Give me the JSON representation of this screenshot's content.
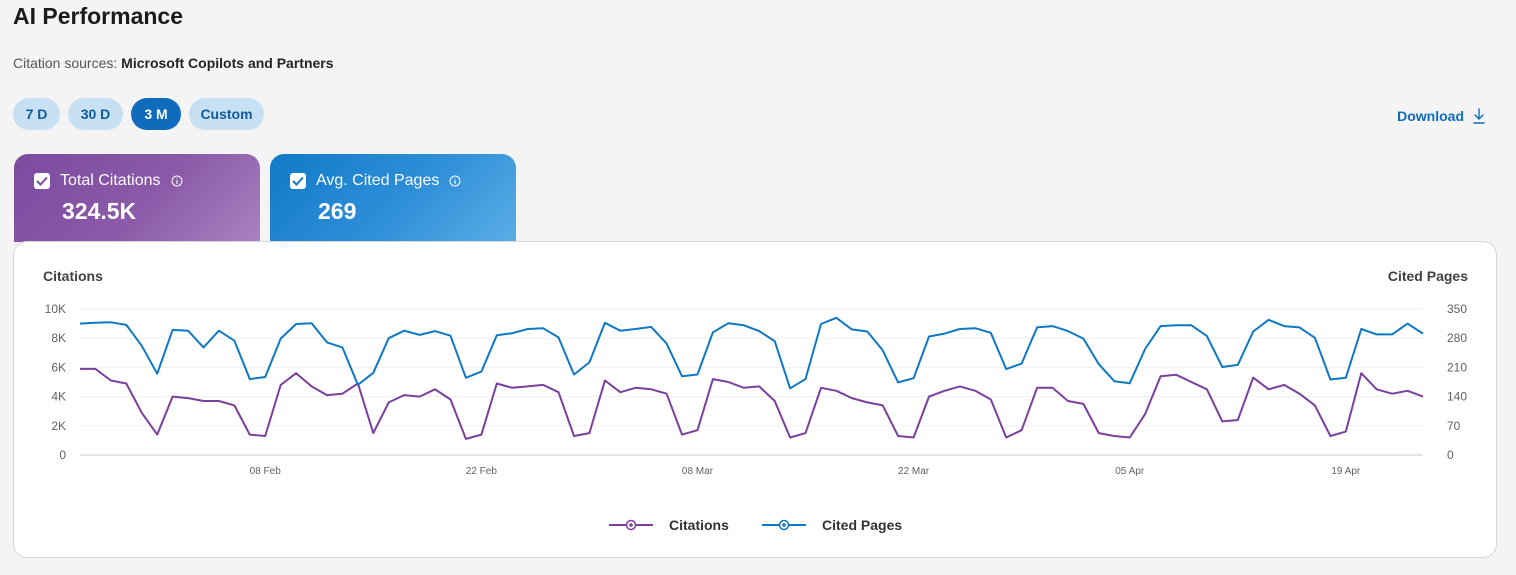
{
  "header": {
    "title": "AI Performance",
    "sources_label": "Citation sources:",
    "sources_value": "Microsoft Copilots and Partners"
  },
  "range_tabs": [
    {
      "label": "7 D",
      "active": false
    },
    {
      "label": "30 D",
      "active": false
    },
    {
      "label": "3 M",
      "active": true
    },
    {
      "label": "Custom",
      "active": false
    }
  ],
  "download_label": "Download",
  "metric_cards": [
    {
      "label": "Total Citations",
      "value": "324.5K",
      "checked": true,
      "color": "#7d4a9e"
    },
    {
      "label": "Avg. Cited Pages",
      "value": "269",
      "checked": true,
      "color": "#117ac8"
    }
  ],
  "chart_data": {
    "type": "line",
    "ylabel_left": "Citations",
    "ylabel_right": "Cited Pages",
    "y_ticks_left": [
      "0",
      "2K",
      "4K",
      "6K",
      "8K",
      "10K"
    ],
    "y_ticks_right": [
      "0",
      "70",
      "140",
      "210",
      "280",
      "350"
    ],
    "ylim_left": [
      0,
      10000
    ],
    "ylim_right": [
      0,
      350
    ],
    "x_tick_labels": [
      "08 Feb",
      "22 Feb",
      "08 Mar",
      "22 Mar",
      "05 Apr",
      "19 Apr"
    ],
    "x_tick_indices": [
      12,
      26,
      40,
      54,
      68,
      82
    ],
    "x_start": "2025-01-27",
    "legend_position": "bottom",
    "series": [
      {
        "name": "Citations",
        "axis": "left",
        "color": "#7b3f9e",
        "values": [
          5900,
          5900,
          5100,
          4900,
          2900,
          1400,
          4000,
          3900,
          3700,
          3700,
          3400,
          1400,
          1300,
          4800,
          5600,
          4700,
          4100,
          4200,
          4900,
          1500,
          3600,
          4100,
          4000,
          4500,
          3800,
          1100,
          1400,
          4900,
          4600,
          4700,
          4800,
          4300,
          1300,
          1500,
          5100,
          4300,
          4600,
          4500,
          4200,
          1400,
          1700,
          5200,
          5000,
          4600,
          4700,
          3700,
          1200,
          1500,
          4600,
          4400,
          3900,
          3600,
          3400,
          1300,
          1200,
          4000,
          4400,
          4700,
          4400,
          3800,
          1200,
          1700,
          4600,
          4600,
          3700,
          3500,
          1500,
          1300,
          1200,
          2800,
          5400,
          5500,
          5000,
          4500,
          2300,
          2400,
          5300,
          4500,
          4800,
          4200,
          3400,
          1300,
          1600,
          5600,
          4500,
          4200,
          4400,
          4000
        ]
      },
      {
        "name": "Cited Pages",
        "axis": "right",
        "color": "#0f78c4",
        "values": [
          315,
          317,
          318,
          312,
          262,
          195,
          300,
          298,
          258,
          298,
          274,
          182,
          187,
          279,
          314,
          316,
          270,
          258,
          168,
          197,
          280,
          298,
          288,
          297,
          286,
          185,
          200,
          287,
          292,
          302,
          304,
          282,
          193,
          222,
          317,
          298,
          302,
          307,
          267,
          189,
          193,
          294,
          316,
          311,
          297,
          273,
          160,
          182,
          314,
          329,
          301,
          296,
          251,
          174,
          184,
          284,
          291,
          302,
          304,
          293,
          206,
          219,
          306,
          309,
          297,
          279,
          218,
          177,
          172,
          254,
          309,
          311,
          311,
          285,
          211,
          216,
          296,
          324,
          309,
          306,
          281,
          181,
          185,
          302,
          289,
          289,
          315,
          291
        ]
      }
    ]
  }
}
